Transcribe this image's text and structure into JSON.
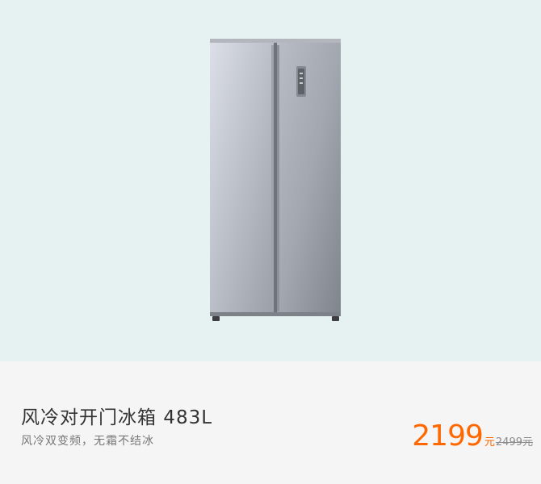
{
  "product": {
    "title": "风冷对开门冰箱 483L",
    "subtitle": "风冷双变频，无霜不结冰",
    "price": "2199",
    "price_unit": "元",
    "original_price": "2499元",
    "image_alt": "refrigerator"
  },
  "colors": {
    "image_background": "#e6f1f2",
    "info_background": "#f5f5f5",
    "price": "#ff6700"
  }
}
